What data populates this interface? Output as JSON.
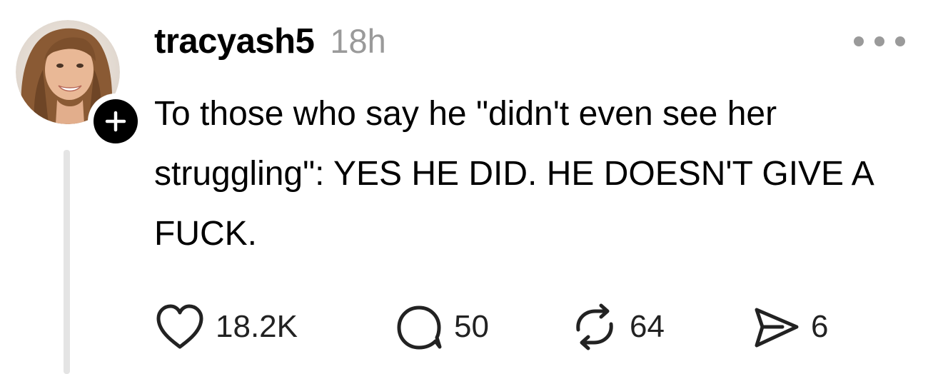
{
  "post": {
    "username": "tracyash5",
    "timestamp": "18h",
    "text": "To those who say he \"didn't even see her struggling\": YES HE DID. HE DOESN'T GIVE A FUCK.",
    "avatar": {
      "icon": "user-avatar-photo",
      "badge_icon": "plus-icon"
    },
    "more_icon": "more-horizontal-icon",
    "actions": {
      "like": {
        "icon": "heart-icon",
        "count": "18.2K"
      },
      "reply": {
        "icon": "comment-bubble-icon",
        "count": "50"
      },
      "repost": {
        "icon": "repost-arrows-icon",
        "count": "64"
      },
      "share": {
        "icon": "send-icon",
        "count": "6"
      }
    }
  },
  "colors": {
    "text": "#000000",
    "muted": "#9a9a9a",
    "thread_line": "#e4e4e4",
    "badge": "#000000"
  }
}
